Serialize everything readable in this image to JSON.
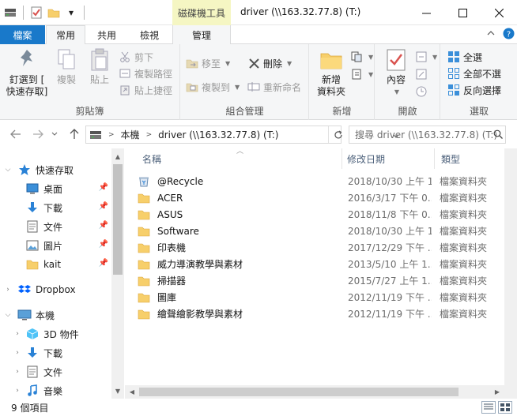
{
  "titlebar": {
    "context_tab_title": "磁碟機工具",
    "title": "driver (\\\\163.32.77.8) (T:)",
    "qat_caret": "▾"
  },
  "tabs": {
    "file": "檔案",
    "home": "常用",
    "share": "共用",
    "view": "檢視",
    "manage": "管理"
  },
  "ribbon": {
    "clipboard": {
      "label": "剪貼簿",
      "pin_line1": "釘選到 [",
      "pin_line2": "快速存取]",
      "copy": "複製",
      "paste": "貼上",
      "cut": "剪下",
      "copy_path": "複製路徑",
      "paste_shortcut": "貼上捷徑"
    },
    "organize": {
      "label": "組合管理",
      "move_to": "移至",
      "copy_to": "複製到",
      "delete": "刪除",
      "rename": "重新命名"
    },
    "new": {
      "label": "新增",
      "new_folder_line1": "新增",
      "new_folder_line2": "資料夾"
    },
    "open": {
      "label": "開啟",
      "properties": "內容"
    },
    "select": {
      "label": "選取",
      "select_all": "全選",
      "select_none": "全部不選",
      "invert": "反向選擇"
    }
  },
  "address": {
    "crumb_pc": "本機",
    "crumb_drive": "driver (\\\\163.32.77.8) (T:)",
    "search_placeholder": "搜尋 driver (\\\\163.32.77.8) (T:)"
  },
  "nav": {
    "quick_access": "快速存取",
    "desktop": "桌面",
    "downloads": "下載",
    "documents": "文件",
    "pictures": "圖片",
    "kait": "kait",
    "dropbox": "Dropbox",
    "this_pc": "本機",
    "objects3d": "3D 物件",
    "pc_downloads": "下載",
    "pc_documents": "文件",
    "music": "音樂"
  },
  "columns": {
    "name": "名稱",
    "date": "修改日期",
    "type": "類型"
  },
  "files": [
    {
      "name": "@Recycle",
      "date": "2018/10/30 上午 1...",
      "type": "檔案資料夾",
      "recycle": true
    },
    {
      "name": "ACER",
      "date": "2016/3/17 下午 0...",
      "type": "檔案資料夾"
    },
    {
      "name": "ASUS",
      "date": "2018/11/8 下午 0...",
      "type": "檔案資料夾"
    },
    {
      "name": "Software",
      "date": "2018/10/30 上午 1...",
      "type": "檔案資料夾"
    },
    {
      "name": "印表機",
      "date": "2017/12/29 下午 ...",
      "type": "檔案資料夾"
    },
    {
      "name": "威力導演教學與素材",
      "date": "2013/5/10 上午 1...",
      "type": "檔案資料夾"
    },
    {
      "name": "掃描器",
      "date": "2015/7/27 上午 1...",
      "type": "檔案資料夾"
    },
    {
      "name": "圖庫",
      "date": "2012/11/19 下午 ...",
      "type": "檔案資料夾"
    },
    {
      "name": "繪聲繪影教學與素材",
      "date": "2012/11/19 下午 ...",
      "type": "檔案資料夾"
    }
  ],
  "status": {
    "count": "9 個項目"
  },
  "colors": {
    "accent": "#1979ca",
    "folder": "#f7cf6b",
    "context_tab": "#f5f6c3"
  }
}
